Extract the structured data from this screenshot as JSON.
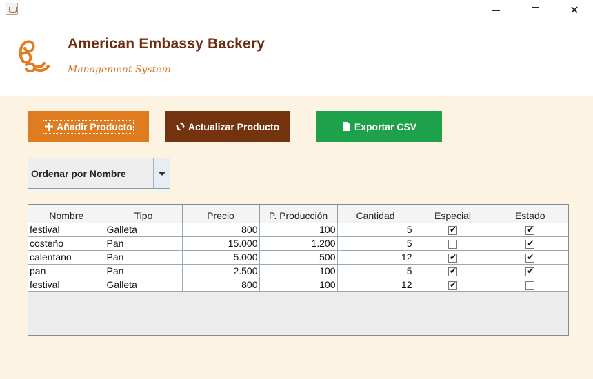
{
  "window": {
    "min_icon": "minimize-icon",
    "max_icon": "maximize-icon",
    "close_glyph": "✕"
  },
  "header": {
    "title": "American Embassy Backery",
    "subtitle": "Management System",
    "logo_icon": "croissant-icon"
  },
  "toolbar": {
    "add_label": "Añadir Producto",
    "update_label": "Actualizar Producto",
    "export_label": "Exportar CSV",
    "add_color": "#de7c1f",
    "update_color": "#74330f",
    "export_color": "#1da14a"
  },
  "sort": {
    "selected": "Ordenar por Nombre"
  },
  "table": {
    "headers": [
      "Nombre",
      "Tipo",
      "Precio",
      "P. Producción",
      "Cantidad",
      "Especial",
      "Estado"
    ],
    "rows": [
      {
        "nombre": "festival",
        "tipo": "Galleta",
        "precio": "800",
        "produccion": "100",
        "cantidad": "5",
        "especial": true,
        "estado": true
      },
      {
        "nombre": "costeño",
        "tipo": "Pan",
        "precio": "15.000",
        "produccion": "1.200",
        "cantidad": "5",
        "especial": false,
        "estado": true
      },
      {
        "nombre": "calentano",
        "tipo": "Pan",
        "precio": "5.000",
        "produccion": "500",
        "cantidad": "12",
        "especial": true,
        "estado": true
      },
      {
        "nombre": "pan",
        "tipo": "Pan",
        "precio": "2.500",
        "produccion": "100",
        "cantidad": "5",
        "especial": true,
        "estado": true
      },
      {
        "nombre": "festival",
        "tipo": "Galleta",
        "precio": "800",
        "produccion": "100",
        "cantidad": "12",
        "especial": true,
        "estado": false
      }
    ]
  }
}
